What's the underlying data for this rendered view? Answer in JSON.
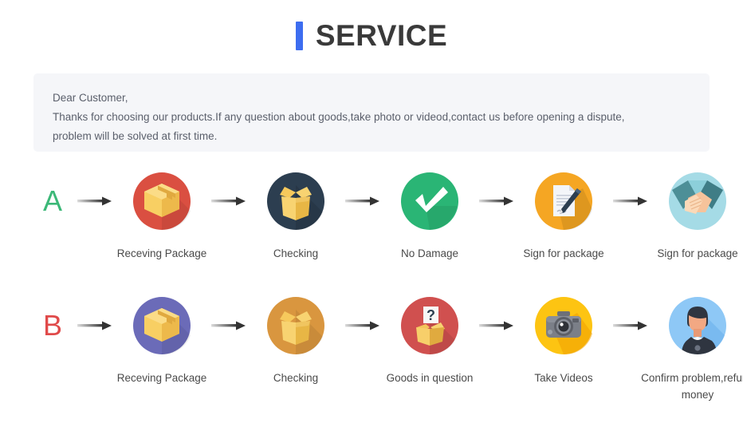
{
  "header": {
    "title": "SERVICE",
    "accent_color": "#3d6df0",
    "title_color": "#3a3a3a"
  },
  "notice": {
    "background_color": "#f5f6f9",
    "text_color": "#5a5f6b",
    "lines": [
      "Dear Customer,",
      "Thanks for choosing our products.If any question about goods,take photo or videod,contact us before opening a dispute,",
      "problem will be solved at first time."
    ]
  },
  "flows": [
    {
      "letter": "A",
      "letter_color": "#3cb878",
      "steps": [
        {
          "icon": "closed-box-icon",
          "circle_color": "#da4f41",
          "label": "Receving Package"
        },
        {
          "icon": "open-box-icon",
          "circle_color": "#2c3e50",
          "label": "Checking"
        },
        {
          "icon": "check-mark-icon",
          "circle_color": "#2ab575",
          "label": "No Damage"
        },
        {
          "icon": "document-pen-icon",
          "circle_color": "#f5a623",
          "label": "Sign for package"
        },
        {
          "icon": "handshake-icon",
          "circle_color": "#a5dbe6",
          "label": "Sign for package"
        }
      ]
    },
    {
      "letter": "B",
      "letter_color": "#e04a4a",
      "steps": [
        {
          "icon": "closed-box-icon",
          "circle_color": "#6b6bb8",
          "label": "Receving Package"
        },
        {
          "icon": "open-box-icon",
          "circle_color": "#d9963f",
          "label": "Checking"
        },
        {
          "icon": "question-box-icon",
          "circle_color": "#d0504f",
          "label": "Goods in question"
        },
        {
          "icon": "camera-icon",
          "circle_color": "#fdc412",
          "label": "Take Videos"
        },
        {
          "icon": "person-icon",
          "circle_color": "#8ec8f6",
          "label": "Confirm problem,refund money"
        }
      ]
    }
  ],
  "arrow": {
    "name": "arrow-right-icon",
    "color_start": "#d0d0d0",
    "color_end": "#3a3a3a"
  }
}
